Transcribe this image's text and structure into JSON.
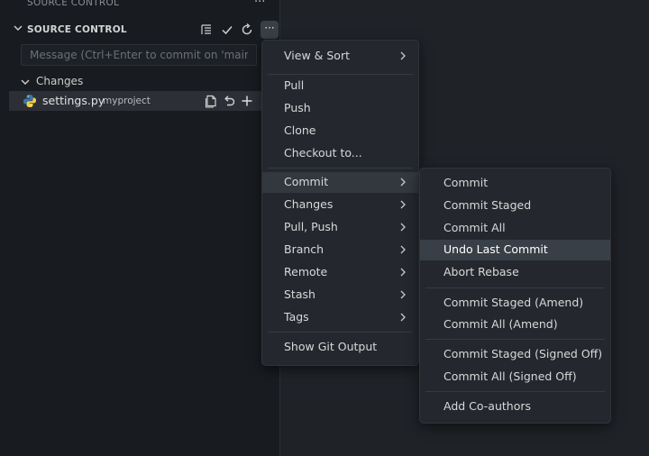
{
  "panel": {
    "top_title": "SOURCE CONTROL",
    "top_more": "···",
    "header_title": "SOURCE CONTROL",
    "more_label": "···"
  },
  "commit_input": {
    "placeholder": "Message (Ctrl+Enter to commit on 'main')"
  },
  "changes": {
    "label": "Changes",
    "files": [
      {
        "name": "settings.py",
        "dir": "myproject"
      }
    ]
  },
  "menu_main": {
    "items": [
      {
        "label": "View & Sort",
        "submenu": true
      },
      {
        "label": "Pull"
      },
      {
        "label": "Push"
      },
      {
        "label": "Clone"
      },
      {
        "label": "Checkout to..."
      },
      {
        "label": "Commit",
        "submenu": true
      },
      {
        "label": "Changes",
        "submenu": true
      },
      {
        "label": "Pull, Push",
        "submenu": true
      },
      {
        "label": "Branch",
        "submenu": true
      },
      {
        "label": "Remote",
        "submenu": true
      },
      {
        "label": "Stash",
        "submenu": true
      },
      {
        "label": "Tags",
        "submenu": true
      },
      {
        "label": "Show Git Output"
      }
    ]
  },
  "menu_commit": {
    "items": [
      {
        "label": "Commit"
      },
      {
        "label": "Commit Staged"
      },
      {
        "label": "Commit All"
      },
      {
        "label": "Undo Last Commit"
      },
      {
        "label": "Abort Rebase"
      },
      {
        "label": "Commit Staged (Amend)"
      },
      {
        "label": "Commit All (Amend)"
      },
      {
        "label": "Commit Staged (Signed Off)"
      },
      {
        "label": "Commit All (Signed Off)"
      },
      {
        "label": "Add Co-authors"
      }
    ]
  },
  "colors": {
    "sidebar_bg": "#181b20",
    "editor_bg": "#1f2328",
    "menu_bg": "#24282e",
    "hover_bg": "#393f47",
    "python_blue": "#3a76b0",
    "python_yellow": "#f2cf4a"
  }
}
